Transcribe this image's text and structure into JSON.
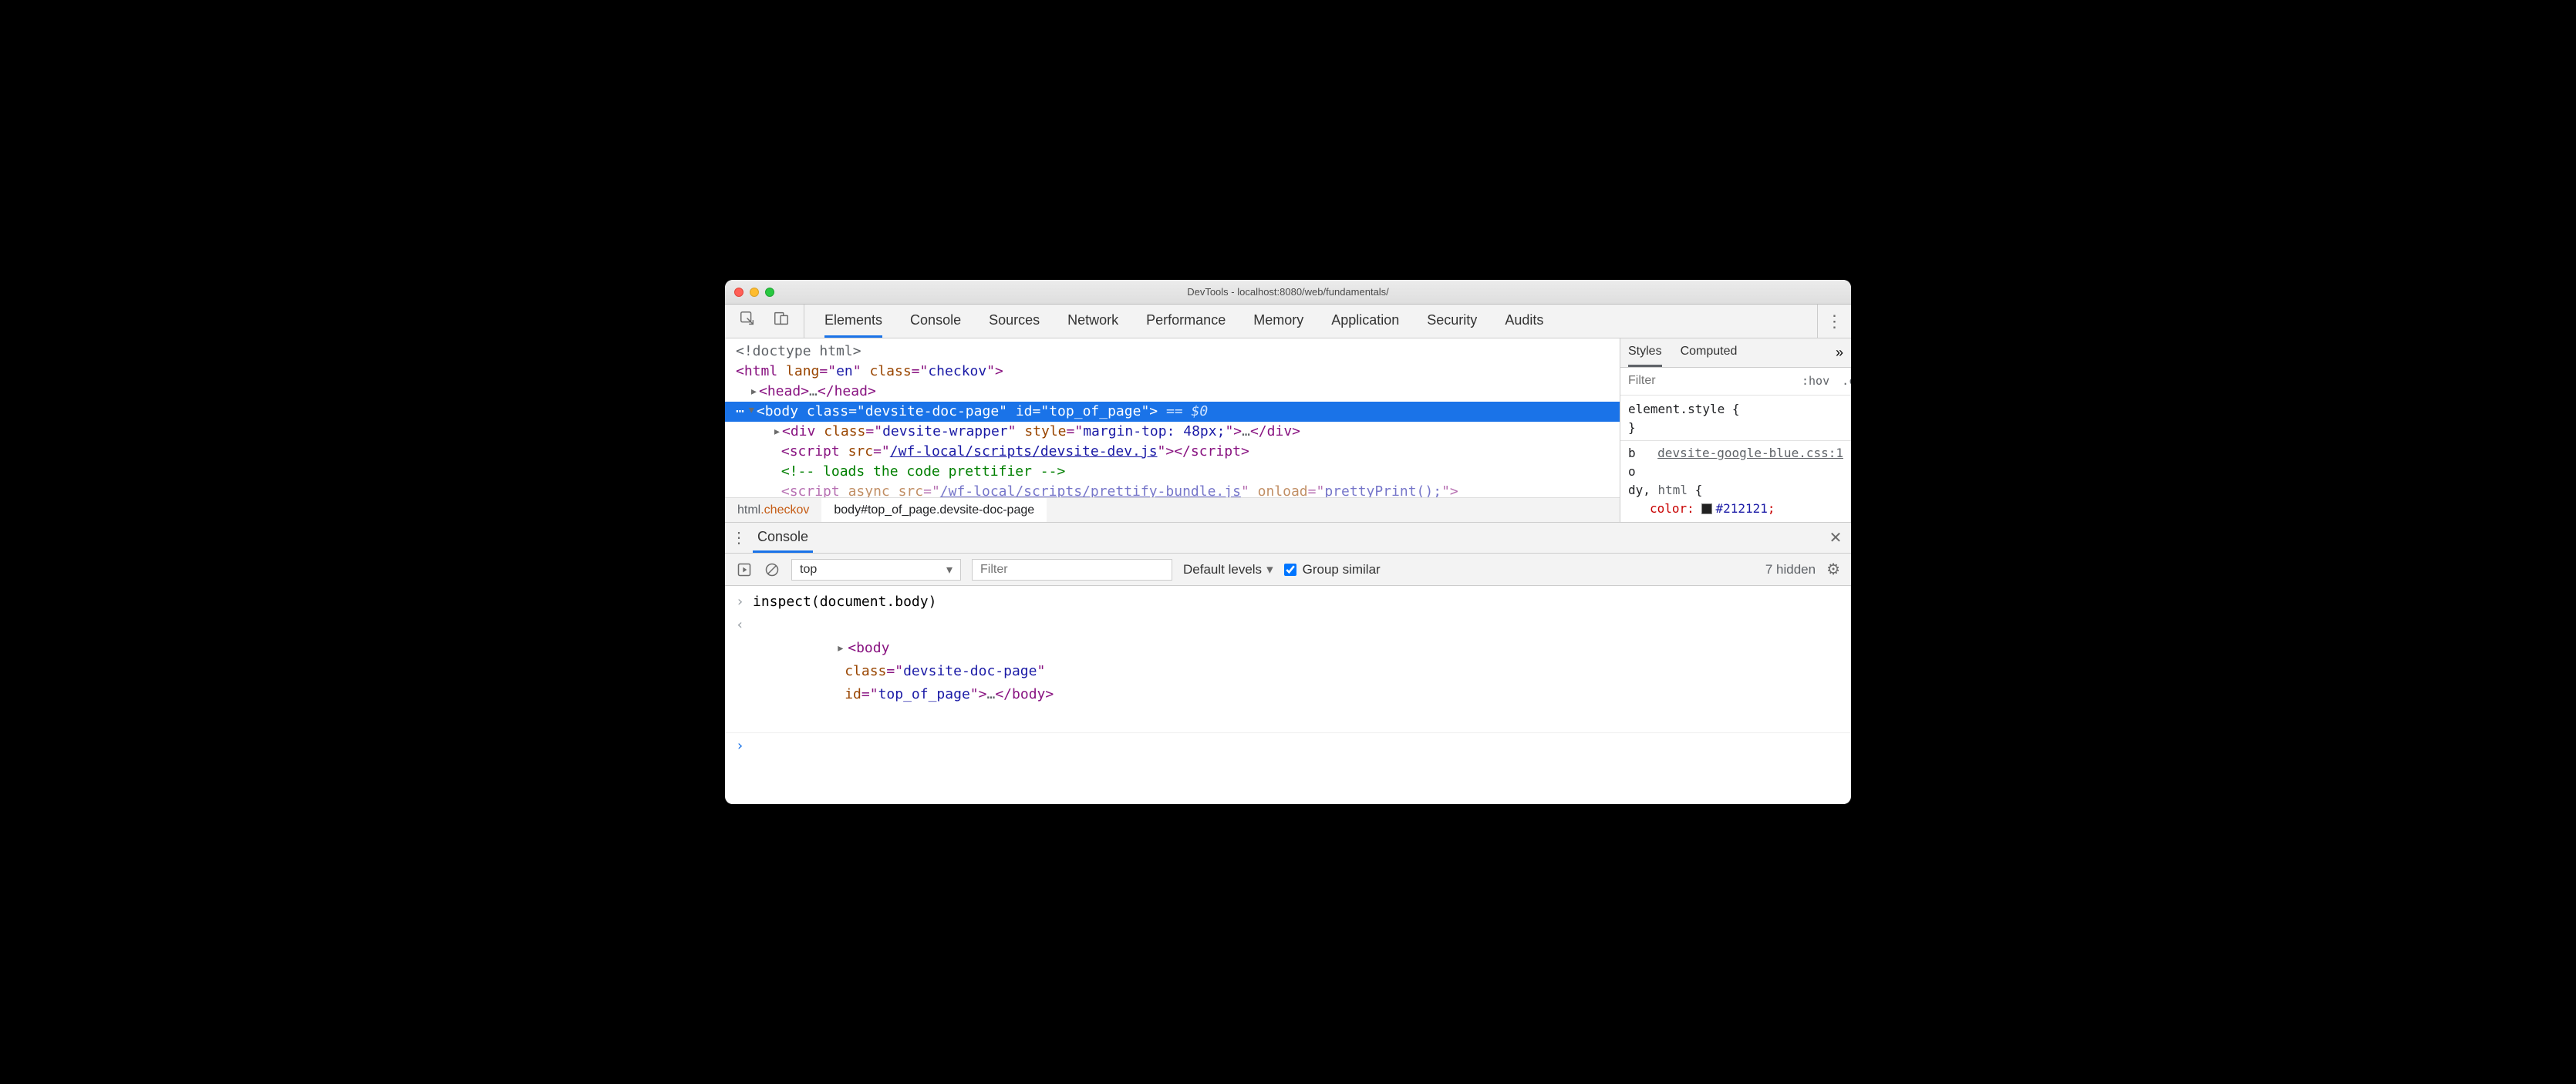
{
  "window": {
    "title": "DevTools - localhost:8080/web/fundamentals/"
  },
  "toolbar": {
    "tabs": [
      "Elements",
      "Console",
      "Sources",
      "Network",
      "Performance",
      "Memory",
      "Application",
      "Security",
      "Audits"
    ],
    "active": "Elements"
  },
  "dom": {
    "doctype": "<!doctype html>",
    "html_open": {
      "lang": "en",
      "class": "checkov"
    },
    "head": "<head>…</head>",
    "body_sel": {
      "class": "devsite-doc-page",
      "id": "top_of_page",
      "eq0": "== $0"
    },
    "div": {
      "class": "devsite-wrapper",
      "style": "margin-top: 48px;"
    },
    "script1": {
      "src": "/wf-local/scripts/devsite-dev.js"
    },
    "comment": "<!-- loads the code prettifier -->",
    "script2": {
      "src": "/wf-local/scripts/prettify-bundle.js",
      "onload": "prettyPrint();"
    }
  },
  "breadcrumb": {
    "first_tag": "html",
    "first_class": ".checkov",
    "second": "body#top_of_page.devsite-doc-page"
  },
  "styles": {
    "tabs": [
      "Styles",
      "Computed"
    ],
    "filter_placeholder": "Filter",
    "hov": ":hov",
    "cls": ".cls",
    "element_style": "element.style {",
    "close_brace": "}",
    "rule_selector_1": "b",
    "rule_selector_2": "o",
    "rule_selector_3": "dy, ",
    "rule_selector_html": "html",
    "rule_brace": " {",
    "rule_source": "devsite-google-blue.css:1",
    "prop_color": "color",
    "val_color": "#212121"
  },
  "drawer": {
    "tab": "Console"
  },
  "console_toolbar": {
    "context": "top",
    "filter_placeholder": "Filter",
    "levels": "Default levels",
    "group": "Group similar",
    "hidden": "7 hidden"
  },
  "console": {
    "input": "inspect(document.body)",
    "result": {
      "class": "devsite-doc-page",
      "id": "top_of_page"
    }
  }
}
